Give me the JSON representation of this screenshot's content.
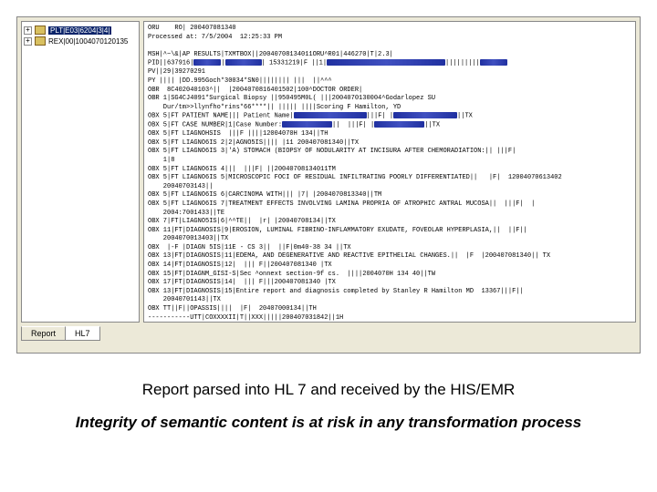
{
  "tree": {
    "items": [
      {
        "toggle": "+",
        "label": "PLT|E03|6204|3|4|",
        "selected": true
      },
      {
        "toggle": "+",
        "label": "REX|00|1004070120135",
        "selected": false
      }
    ]
  },
  "header": {
    "line1": "ORU    RO| 200407081340",
    "line2": "Processed at: 7/5/2004  12:25:33 PM"
  },
  "hl7_lines": [
    "MSH|^~\\&|AP RESULTS|TXMTBOX||20040708134011ORU^R01|446270|T|2.3|",
    "PID||637916|@@@@@R1|@@@@@R2| 15331219|F ||1|@@@@@@@@@@@@@@@R3|||||||||@@@@@R4",
    "PV||29|39270291",
    "PY |||| |DD.995Goch*30034*SN0|||||||| |||  ||^^^",
    "OBR  8C402040103^||  |2004070816401502|100^DOCTOR ORDER|",
    "OBR 1|SG4CJ4091*Surgical Biopsy ||950495M0L( |||2004070130004^Godarlopez SU",
    "    Dur/tm>>llynfho*rins*66****|| ||||| ||||Scoring F Hamilton, YD",
    "OBX 5|FT PATIENT NAME||| Patient Name|@@@@@@@@@@@@@R5|||F| |@@@@@@@@@@R6||TX",
    "OBX 5|FT CASE NUMBER|1|Case Number:@@@@@@@@R7||  |||F| |@@@@@@@@R8||TX",
    "OBX 5|FT LIAGNOHSIS  |||F ||||12004070H 134||TH",
    "OBX 5|FT LIAGNO6IS 2|2|AGNO5IS|||| |11 200407081340||TX",
    "OBX 5|FT LIAGNO6IS 3|'A) STOMACH (BIOPSY OF NODULARITY AT INCISURA AFTER CHEMORADIATION:|| |||F|",
    "    1|8",
    "OBX 5|FT LIAGNO6IS 4|||  |||F| ||20040708134011TM",
    "OBX 5|FT LIAGNO6IS 5|MICROSCOPIC FOCI OF RESIDUAL INFILTRATING POORLY DIFFERENTIATED||   |F|  12004070613402",
    "    20040703143||",
    "OBX 5|FT LIAGNO6IS 6|CARCINOMA WITH||| |7| |2004070813340||TM",
    "OBX 5|FT LIAGNO6IS 7|TREATMENT EFFECTS INVOLVING LAMINA PROPRIA OF ATROPHIC ANTRAL MUCOSA||  |||F|  |",
    "    2004:7001433||TE",
    "OBX 7|FT|LIAGNO5IS|6|^^TE||  |r| |20040708134||TX",
    "OBX 11|FT|DIAGNOSIS|9|EROSION, LUMINAL FIBRINO-INFLAMMATORY EXUDATE, FOVEOLAR HYPERPLASIA,||  ||F||",
    "    2004070013403||TX",
    "OBX  |-F |DIAGN 5IS|11E - CS 3||  ||F|0m40-38 34 ||TX",
    "OBX 13|FT|DIAGNOSIS|11|EDEMA, AND DEGENERATIVE AND REACTIVE EPITHELIAL CHANGES.||  |F  |200407081340|| TX",
    "OBX 14|FT|DIAGNOSIS|12|  ||| F||200407081340 |TX",
    "OBX 15|FT|DIAGNM_GISI-S|Sec ^onnext section-9f cs.  ||||2004070H 134 40||TW",
    "OBX 17|FT|DIAGNOSIS|14|  ||| F|||200407081340 |TX",
    "OBX 13|FT|DIAGNOSIS|15|Entire report and diagnosis completed by Stanley R Hamilton MD  13367|||F||",
    "    20040701143||TX",
    "OBX TT||F||OPASSIS||||  |F|  20407000134||TH",
    "-----------UTT|COXXXXII|T||XXX|||||200407031842||1H"
  ],
  "redactions": {
    "R1": 30,
    "R2": 40,
    "R3": 130,
    "R4": 30,
    "R5": 80,
    "R6": 70,
    "R7": 55,
    "R8": 55
  },
  "tabs": {
    "report": "Report",
    "hl7": "HL7"
  },
  "caption1": "Report parsed into HL 7 and received by the HIS/EMR",
  "caption2": "Integrity of semantic content is at risk in any transformation process"
}
